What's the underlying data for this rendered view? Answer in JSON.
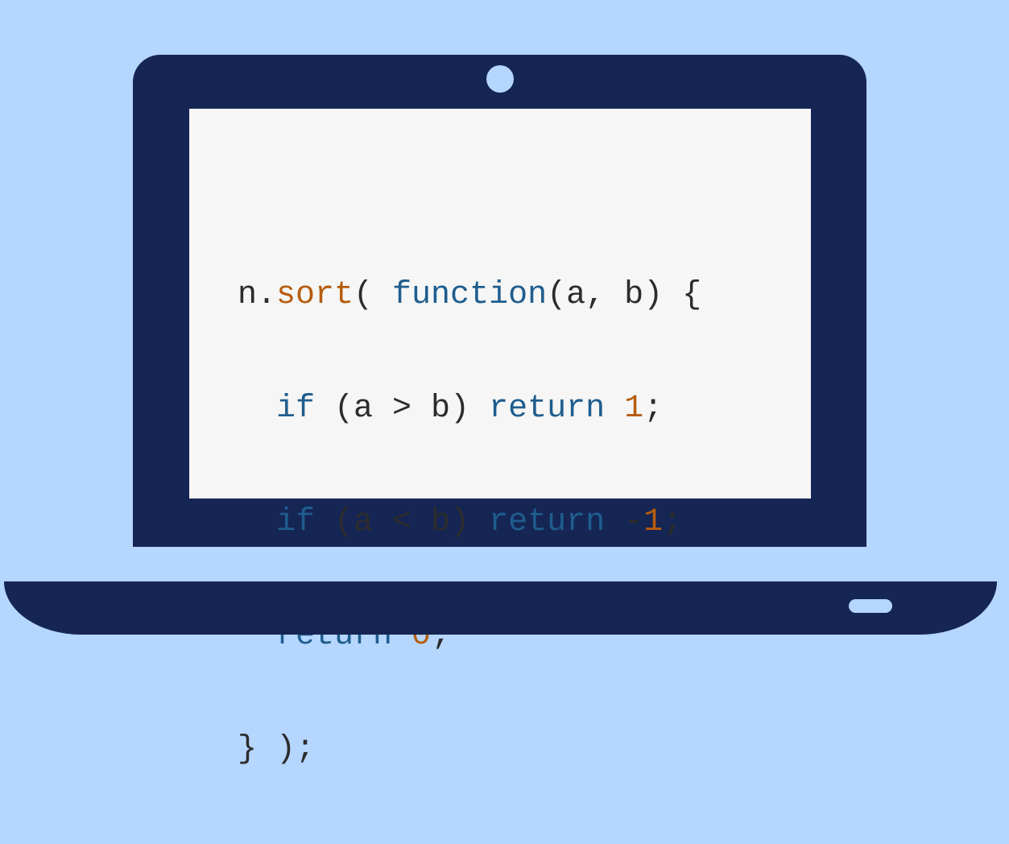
{
  "colors": {
    "background": "#b5d6fe",
    "laptop_body": "#152554",
    "screen": "#f6f6f6",
    "code_default": "#2c2c2c",
    "code_keyword": "#1f5d8e",
    "code_number": "#b65d0e"
  },
  "icons": {
    "camera": "webcam-dot",
    "port": "usb-port"
  },
  "code": {
    "line1": {
      "obj": "n.",
      "method": "sort",
      "open": "( ",
      "kw": "function",
      "rest": "(a, b) {"
    },
    "line2": {
      "kw1": "if",
      "cond": " (a > b) ",
      "kw2": "return",
      "space": " ",
      "num": "1",
      "end": ";"
    },
    "line3": {
      "kw1": "if",
      "cond": " (a < b) ",
      "kw2": "return",
      "space": " -",
      "num": "1",
      "end": ";"
    },
    "line4": {
      "kw": "return",
      "space": " ",
      "num": "0",
      "end": ";"
    },
    "line5": {
      "text": "} );"
    }
  }
}
